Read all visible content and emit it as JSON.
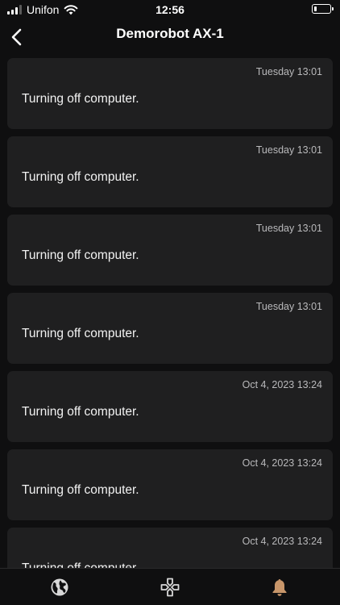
{
  "status_bar": {
    "carrier": "Unifon",
    "time": "12:56",
    "battery_level": 0.15
  },
  "header": {
    "title": "Demorobot AX-1",
    "back_icon": "chevron-left-icon"
  },
  "notifications": [
    {
      "time": "Tuesday 13:01",
      "message": "Turning off computer."
    },
    {
      "time": "Tuesday 13:01",
      "message": "Turning off computer."
    },
    {
      "time": "Tuesday 13:01",
      "message": "Turning off computer."
    },
    {
      "time": "Tuesday 13:01",
      "message": "Turning off computer."
    },
    {
      "time": "Oct 4, 2023 13:24",
      "message": "Turning off computer."
    },
    {
      "time": "Oct 4, 2023 13:24",
      "message": "Turning off computer."
    },
    {
      "time": "Oct 4, 2023 13:24",
      "message": "Turning off computer."
    }
  ],
  "tabbar": {
    "tabs": [
      {
        "icon": "globe-icon",
        "active": false
      },
      {
        "icon": "gamepad-icon",
        "active": false
      },
      {
        "icon": "bell-icon",
        "active": true
      }
    ],
    "inactive_color": "#d8d8d8",
    "active_color": "#c8966a"
  },
  "colors": {
    "background": "#0f0f10",
    "card": "#1f1f20",
    "timestamp": "#b9b9bb"
  }
}
